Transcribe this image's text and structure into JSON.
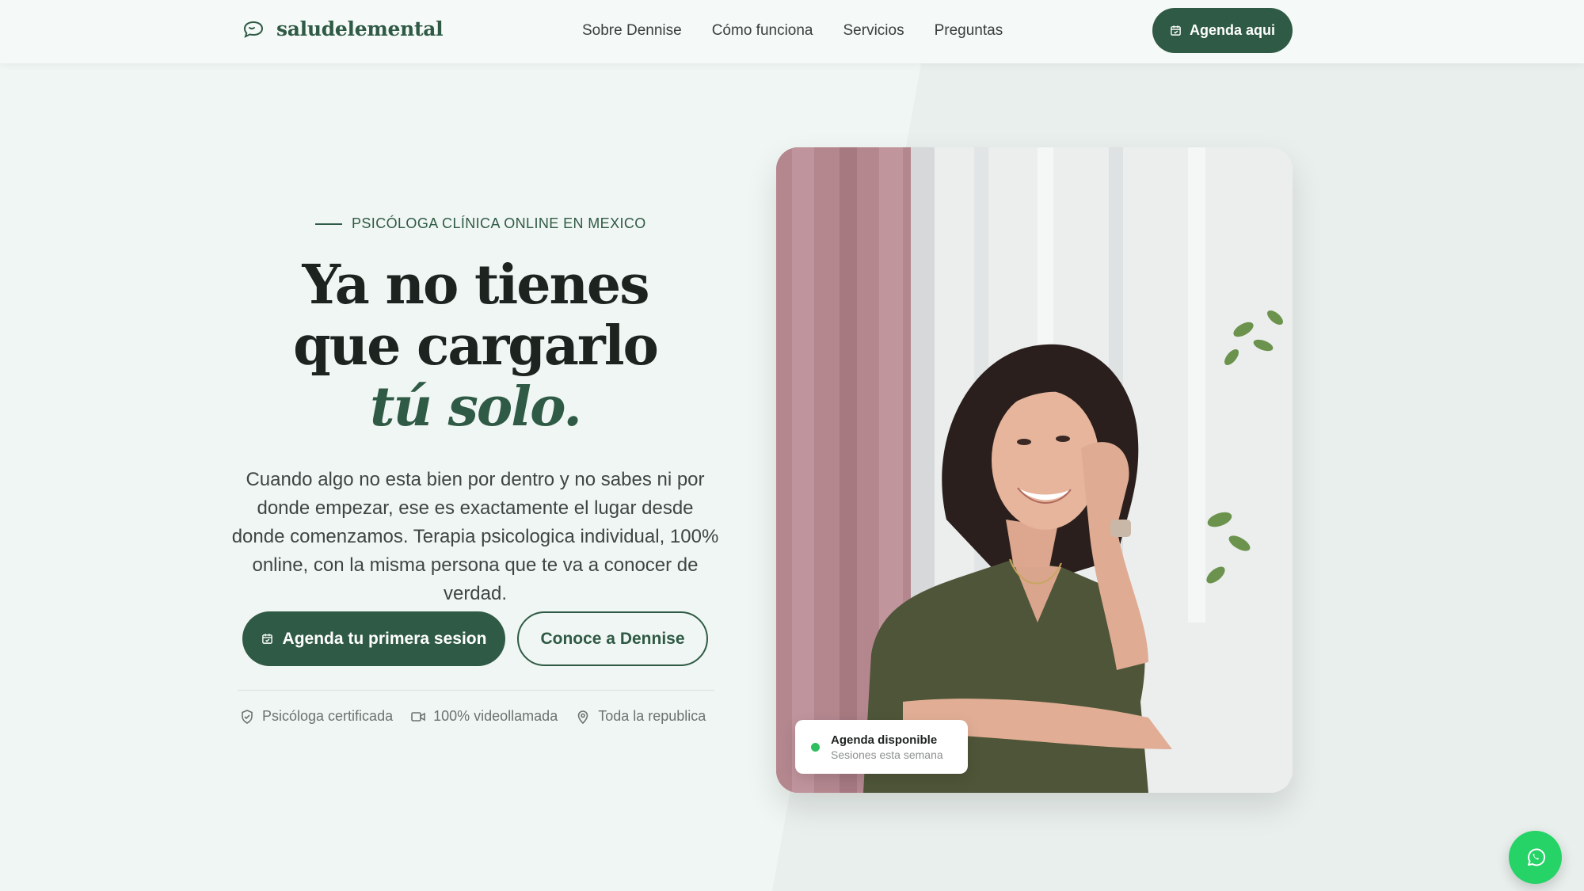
{
  "brand": {
    "name": "saludelemental",
    "icon": "speech-bubble-icon"
  },
  "nav": {
    "links": [
      {
        "label": "Sobre Dennise"
      },
      {
        "label": "Cómo funciona"
      },
      {
        "label": "Servicios"
      },
      {
        "label": "Preguntas"
      }
    ],
    "cta_label": "Agenda aqui",
    "cta_icon": "calendar-icon"
  },
  "hero": {
    "eyebrow": "PSICÓLOGA CLÍNICA ONLINE EN MEXICO",
    "headline_line1": "Ya no tienes",
    "headline_line2": "que cargarlo",
    "headline_accent": "tú solo.",
    "lead": "Cuando algo no esta bien por dentro y no sabes ni por donde empezar, ese es exactamente el lugar desde donde comenzamos. Terapia psicologica individual, 100% online, con la misma persona que te va a conocer de verdad.",
    "primary_button": "Agenda tu primera sesion",
    "secondary_button": "Conoce a Dennise",
    "trust": [
      {
        "label": "Psicóloga certificada",
        "icon": "shield-check-icon"
      },
      {
        "label": "100% videollamada",
        "icon": "video-camera-icon"
      },
      {
        "label": "Toda la republica",
        "icon": "map-pin-icon"
      }
    ]
  },
  "photo_badge": {
    "title": "Agenda disponible",
    "subtitle": "Sesiones esta semana",
    "status_color": "#2fbf60"
  },
  "floating": {
    "icon": "whatsapp-icon"
  },
  "colors": {
    "primary": "#2f5a45",
    "background": "#f0f6f3",
    "whatsapp": "#25d366"
  }
}
